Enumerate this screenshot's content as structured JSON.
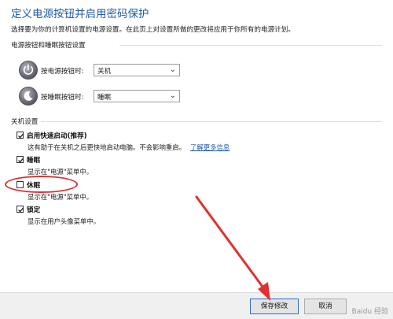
{
  "header": {
    "title": "定义电源按钮并启用密码保护",
    "description": "选择要为你的计算机设置的电源设置。在此页上对设置所做的更改将应用于你所有的电源计划。"
  },
  "power_section": {
    "heading": "电源按钮和睡眠按钮设置",
    "rows": [
      {
        "label": "按电源按钮时:",
        "value": "关机"
      },
      {
        "label": "按睡眠按钮时:",
        "value": "睡眠"
      }
    ]
  },
  "shutdown_section": {
    "heading": "关机设置",
    "options": [
      {
        "title": "启用快速启动(推荐)",
        "desc": "这有助于在关机之后更快地启动电脑。不会影响重启。",
        "link": "了解更多信息",
        "checked": true
      },
      {
        "title": "睡眠",
        "desc": "显示在\"电源\"菜单中。",
        "checked": true
      },
      {
        "title": "休眠",
        "desc": "显示在\"电源\"菜单中。",
        "checked": false
      },
      {
        "title": "锁定",
        "desc": "显示在用户头像菜单中。",
        "checked": true
      }
    ]
  },
  "footer": {
    "save_label": "保存修改",
    "cancel_label": "取消"
  },
  "watermark": "Baidu 经验",
  "colors": {
    "title": "#1f5aa6",
    "link": "#1f5aa6",
    "annotation": "#e03030",
    "primary_border": "#2f6fc6"
  },
  "icons": {
    "power_button": "power-icon",
    "sleep_button": "moon-icon",
    "checkbox": "check-icon",
    "dropdown": "chevron-down-icon"
  }
}
